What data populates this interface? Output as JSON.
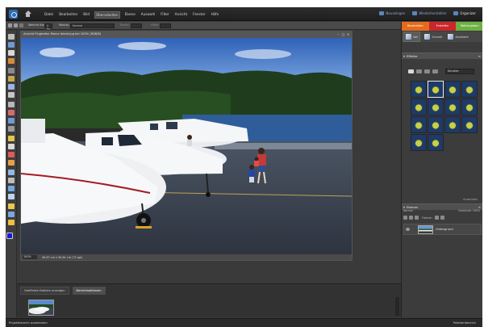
{
  "menu": {
    "items": [
      "Datei",
      "Bearbeiten",
      "Bild",
      "Überarbeiten",
      "Ebene",
      "Auswahl",
      "Filter",
      "Ansicht",
      "Fenster",
      "Hilfe"
    ],
    "active_index": 3,
    "right": {
      "new": "Neuanlegen",
      "restore": "Wiederherstellen",
      "organizer": "Organizer"
    }
  },
  "options_bar": {
    "tip_label": "Weiche Kante:",
    "tip_value": "0 Px",
    "mode_label": "Modus:",
    "mode_value": "Normal",
    "width_label": "Breite:",
    "height_label": "Höhe:"
  },
  "document": {
    "title": "Ansicht Flughafen-Marco Island.jpg bei 100% (RGB/8)",
    "zoom": "100%",
    "size_info": "40,67 cm x 30,81 cm (72 ppi)"
  },
  "bin": {
    "tabs": [
      "Geöffnete Dateien anzeigen",
      "Bereichsaktionen"
    ],
    "active_tab": 1
  },
  "bottom_bar": {
    "left": "Projektbereich ausblenden",
    "right": "Palettenbereich"
  },
  "right_panel": {
    "mode_tabs": [
      {
        "label": "Bearbeiten",
        "color": "#e46b1c"
      },
      {
        "label": "Erstellen",
        "color": "#c9272a"
      },
      {
        "label": "Weitergeben",
        "color": "#6fb043"
      }
    ],
    "subtabs": [
      "Voll",
      "Schnell",
      "Assistent"
    ],
    "active_subtab": 0,
    "effects": {
      "title": "Effekte",
      "category": "Künstler",
      "apply_label": "Anwenden"
    },
    "layers": {
      "title": "Ebenen",
      "opts_left": "Normal",
      "opts_right": "Deckkraft: 100%",
      "lock_label": "Fixieren:",
      "layer_name": "Hintergrund"
    }
  }
}
